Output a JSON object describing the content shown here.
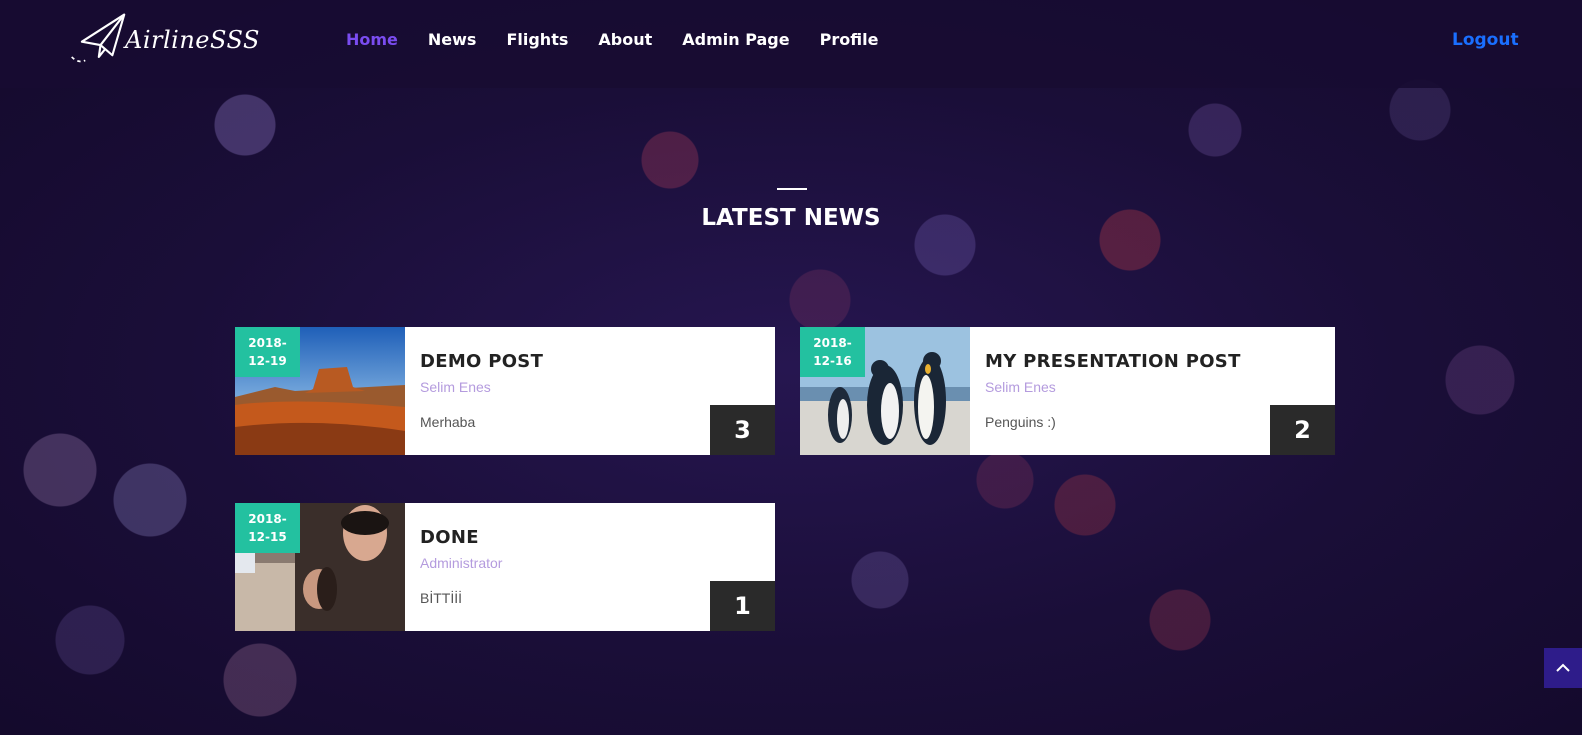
{
  "brand": {
    "name": "AirlineSSS"
  },
  "nav": {
    "items": [
      {
        "label": "Home",
        "active": true
      },
      {
        "label": "News",
        "active": false
      },
      {
        "label": "Flights",
        "active": false
      },
      {
        "label": "About",
        "active": false
      },
      {
        "label": "Admin Page",
        "active": false
      },
      {
        "label": "Profile",
        "active": false
      }
    ],
    "logout": "Logout"
  },
  "section": {
    "title": "LATEST NEWS"
  },
  "posts": [
    {
      "date_line1": "2018-",
      "date_line2": "12-19",
      "title": "DEMO POST",
      "author": "Selim Enes",
      "excerpt": "Merhaba",
      "count": "3",
      "image": "desert-canyon"
    },
    {
      "date_line1": "2018-",
      "date_line2": "12-16",
      "title": "MY PRESENTATION POST",
      "author": "Selim Enes",
      "excerpt": "Penguins :)",
      "count": "2",
      "image": "penguins"
    },
    {
      "date_line1": "2018-",
      "date_line2": "12-15",
      "title": "DONE",
      "author": "Administrator",
      "excerpt": "BİTTİİİ",
      "count": "1",
      "image": "people-photo"
    }
  ],
  "colors": {
    "accent": "#7a4cf0",
    "date_badge": "#23c1a0",
    "logout": "#1a6fff",
    "author": "#b49bde",
    "count_badge": "#2a2a2a"
  },
  "icons": {
    "logo": "paper-plane-icon",
    "scroll_top": "chevron-up-icon"
  }
}
